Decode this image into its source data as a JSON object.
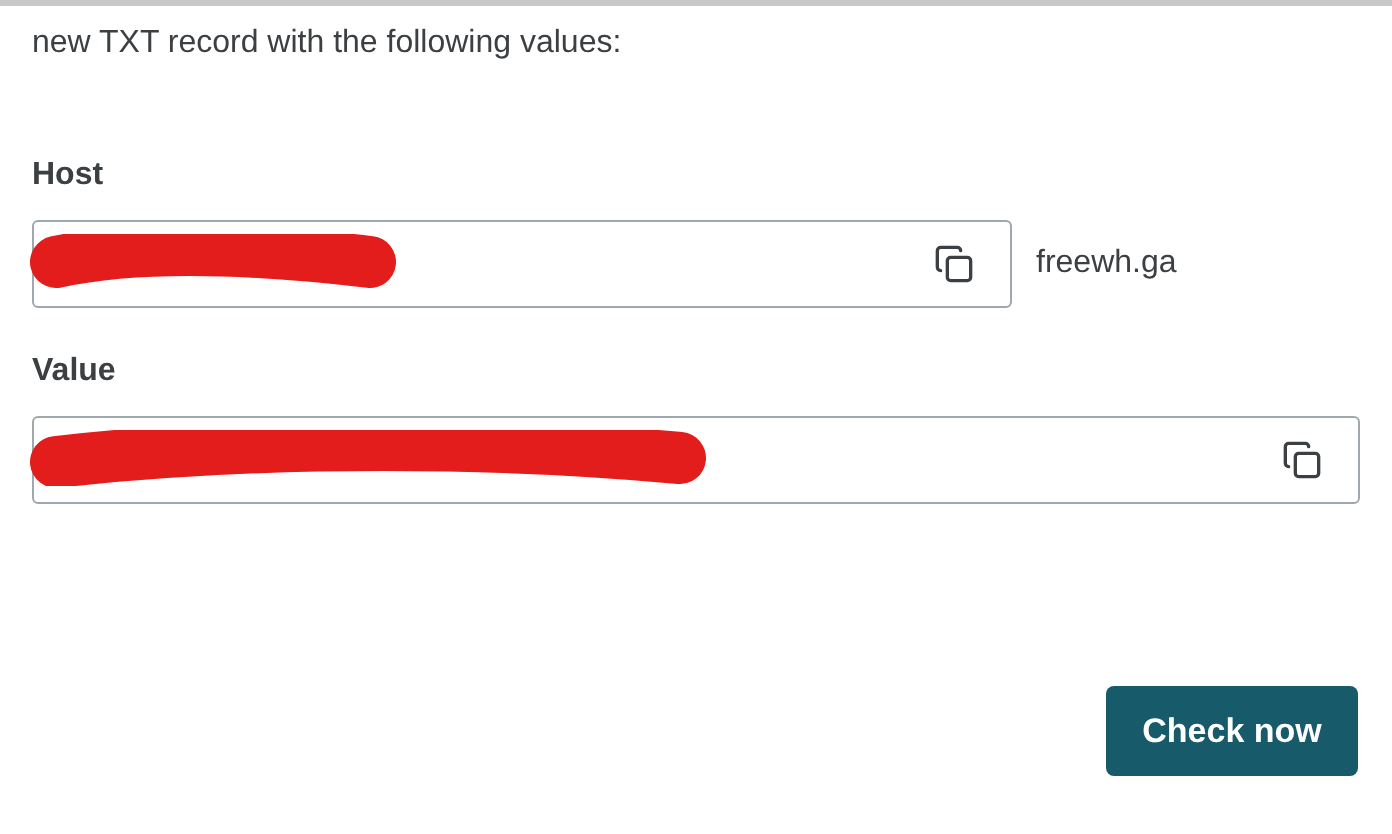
{
  "intro": "new TXT record with the following values:",
  "fields": [
    {
      "label": "Host",
      "redacted": true,
      "suffix": "freewh.ga"
    },
    {
      "label": "Value",
      "redacted": true
    }
  ],
  "button": "Check now"
}
